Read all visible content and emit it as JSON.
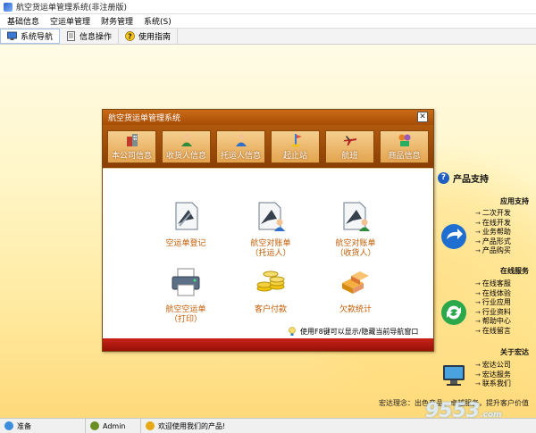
{
  "window": {
    "title": "航空货运单管理系统(非注册版)"
  },
  "menubar": {
    "items": [
      "基础信息",
      "空运单管理",
      "财务管理",
      "系统(S)"
    ]
  },
  "toolbar": {
    "items": [
      "系统导航",
      "信息操作",
      "使用指南"
    ]
  },
  "dialog": {
    "title": "航空货运单管理系统",
    "close": "✕",
    "nav": [
      "本公司信息",
      "收货人信息",
      "托运人信息",
      "起止站",
      "航班",
      "商品信息"
    ],
    "actions": [
      {
        "line1": "空运单登记",
        "line2": ""
      },
      {
        "line1": "航空对账单",
        "line2": "（托运人）"
      },
      {
        "line1": "航空对账单",
        "line2": "（收货人）"
      },
      {
        "line1": "航空空运单",
        "line2": "（打印）"
      },
      {
        "line1": "客户付款",
        "line2": ""
      },
      {
        "line1": "欠款统计",
        "line2": ""
      }
    ],
    "hint": "使用F8键可以显示/隐藏当前导航窗口"
  },
  "side": {
    "title": "产品支持",
    "sections": [
      {
        "heading": "应用支持",
        "items": [
          "二次开发",
          "在线开发",
          "业务帮助",
          "产品形式",
          "产品购买"
        ]
      },
      {
        "heading": "在线服务",
        "items": [
          "在线客服",
          "在线体验",
          "行业应用",
          "行业资料",
          "帮助中心",
          "在线留言"
        ]
      },
      {
        "heading": "关于宏达",
        "items": [
          "宏达公司",
          "宏达服务",
          "联系我们"
        ]
      }
    ],
    "slogan": "宏达理念：出色产品，卓越服务，提升客户价值"
  },
  "watermark": {
    "main": "9553",
    "sub": ".com"
  },
  "statusbar": {
    "status": "准备",
    "user": "Admin",
    "message": "欢迎使用我们的产品!"
  }
}
